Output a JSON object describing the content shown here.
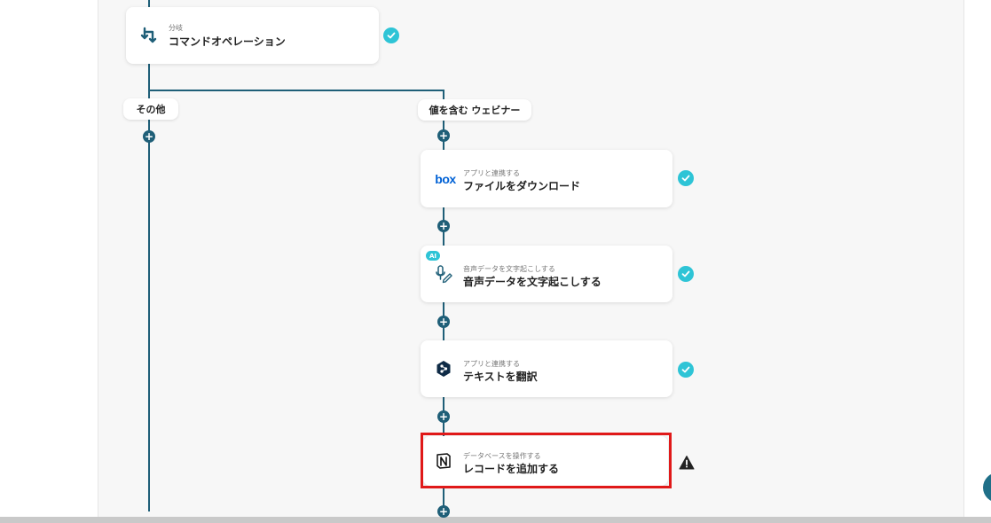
{
  "flow": {
    "branch": {
      "sub": "分岐",
      "title": "コマンドオペレーション"
    },
    "labels": {
      "other": "その他",
      "contains": "値を含む ウェビナー"
    },
    "steps": [
      {
        "sub": "アプリと連携する",
        "title": "ファイルをダウンロード",
        "icon": "box-logo-icon",
        "logo_text": "box",
        "status": "done"
      },
      {
        "sub": "音声データを文字起こしする",
        "title": "音声データを文字起こしする",
        "icon": "microphone-pen-icon",
        "badge": "AI",
        "status": "done"
      },
      {
        "sub": "アプリと連携する",
        "title": "テキストを翻訳",
        "icon": "deepl-logo-icon",
        "status": "done"
      },
      {
        "sub": "データベースを操作する",
        "title": "レコードを追加する",
        "icon": "notion-logo-icon",
        "status": "warning"
      }
    ],
    "add_symbol": "+"
  },
  "colors": {
    "connector": "#1f5f78",
    "check": "#2ec4d6",
    "highlight": "#e01919",
    "box_blue": "#0061d5"
  }
}
